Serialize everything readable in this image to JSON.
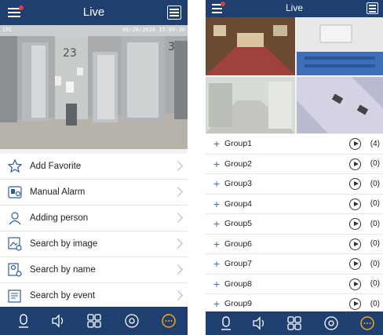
{
  "left": {
    "title": "Live",
    "osd": {
      "channel": "IPC",
      "timestamp": "06/20/2020 15:09:36"
    },
    "menu": [
      {
        "label": "Add Favorite",
        "icon": "star-icon"
      },
      {
        "label": "Manual Alarm",
        "icon": "alarm-icon"
      },
      {
        "label": "Adding person",
        "icon": "person-add-icon"
      },
      {
        "label": "Search by image",
        "icon": "image-search-icon"
      },
      {
        "label": "Search by name",
        "icon": "name-search-icon"
      },
      {
        "label": "Search by event",
        "icon": "event-search-icon"
      }
    ]
  },
  "right": {
    "title": "Live",
    "groups": [
      {
        "name": "Group1",
        "count": "(4)"
      },
      {
        "name": "Group2",
        "count": "(0)"
      },
      {
        "name": "Group3",
        "count": "(0)"
      },
      {
        "name": "Group4",
        "count": "(0)"
      },
      {
        "name": "Group5",
        "count": "(0)"
      },
      {
        "name": "Group6",
        "count": "(0)"
      },
      {
        "name": "Group7",
        "count": "(0)"
      },
      {
        "name": "Group8",
        "count": "(0)"
      },
      {
        "name": "Group9",
        "count": "(0)"
      }
    ]
  },
  "footer_icons": [
    "talk-icon",
    "speaker-icon",
    "layout-icon",
    "ptz-icon",
    "more-icon"
  ],
  "colors": {
    "bar": "#1e3f6f",
    "accent": "#f5a623"
  }
}
